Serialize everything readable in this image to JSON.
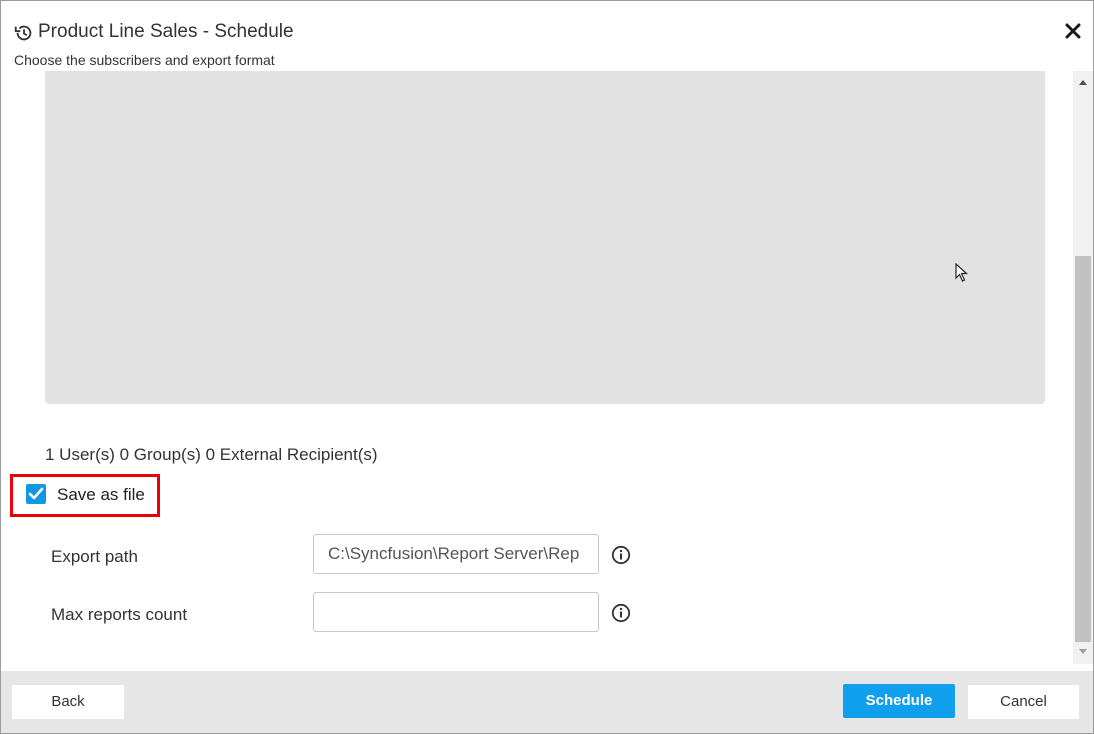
{
  "header": {
    "title": "Product Line Sales - Schedule",
    "subtitle": "Choose the subscribers and export format",
    "icon": "history-icon"
  },
  "content": {
    "recipients_summary": "1 User(s) 0 Group(s) 0 External Recipient(s)",
    "save_as_file": {
      "label": "Save as file",
      "checked": true
    },
    "export_path": {
      "label": "Export path",
      "value": "C:\\Syncfusion\\Report Server\\Rep"
    },
    "max_reports_count": {
      "label": "Max reports count",
      "value": ""
    }
  },
  "footer": {
    "back_label": "Back",
    "schedule_label": "Schedule",
    "cancel_label": "Cancel"
  },
  "colors": {
    "accent": "#0f9fed",
    "checkbox": "#1497e3",
    "highlight": "#e8000b"
  }
}
